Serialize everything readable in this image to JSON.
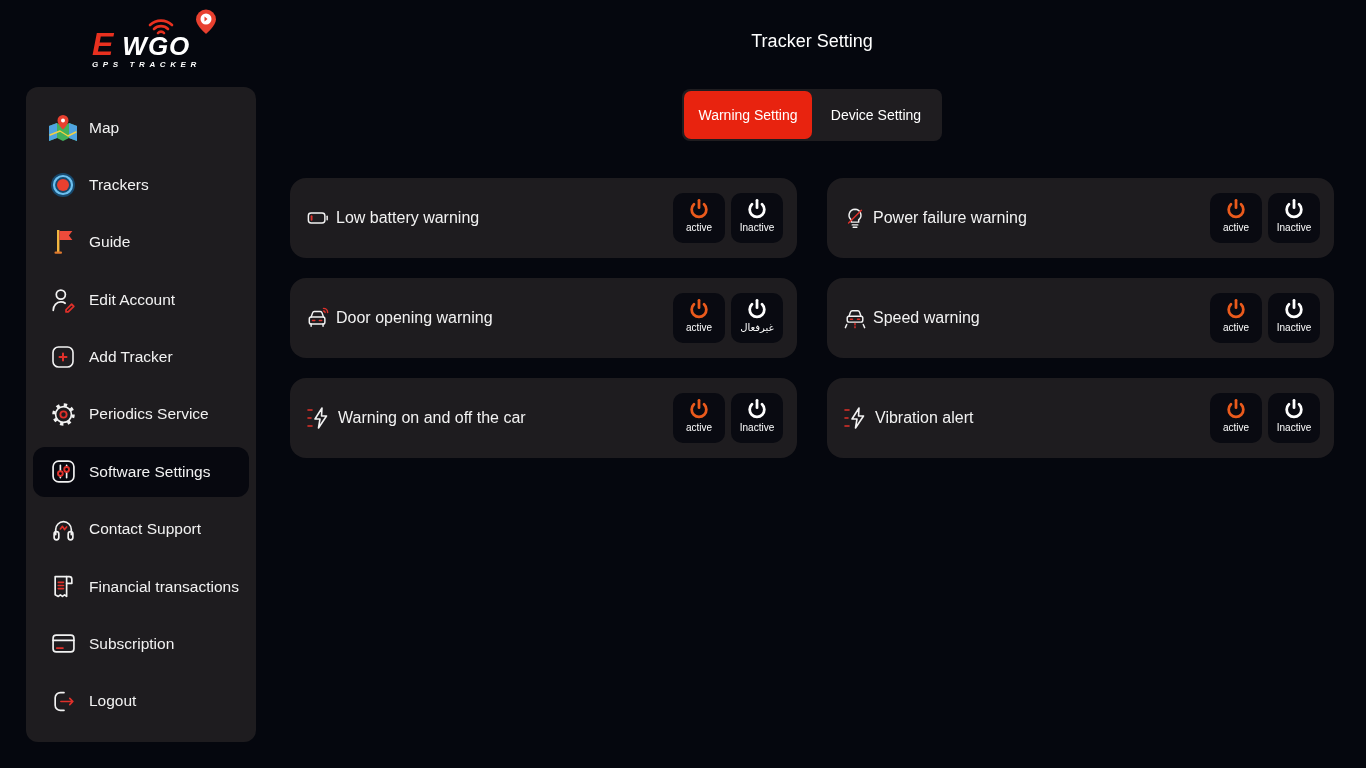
{
  "logo": {
    "mark": "E",
    "wordmark": "WGO",
    "tagline": "GPS TRACKER"
  },
  "sidebar": {
    "items": [
      {
        "label": "Map",
        "kind": "map",
        "selected": false
      },
      {
        "label": "Trackers",
        "kind": "target",
        "selected": false
      },
      {
        "label": "Guide",
        "kind": "flag",
        "selected": false
      },
      {
        "label": "Edit Account",
        "kind": "user",
        "selected": false
      },
      {
        "label": "Add Tracker",
        "kind": "plus",
        "selected": false
      },
      {
        "label": "Periodics Service",
        "kind": "gear",
        "selected": false
      },
      {
        "label": "Software Settings",
        "kind": "sliders",
        "selected": true
      },
      {
        "label": "Contact Support",
        "kind": "headset",
        "selected": false
      },
      {
        "label": "Financial transactions",
        "kind": "receipt",
        "selected": false
      },
      {
        "label": "Subscription",
        "kind": "card",
        "selected": false
      },
      {
        "label": "Logout",
        "kind": "logout",
        "selected": false
      }
    ]
  },
  "page": {
    "title": "Tracker Setting"
  },
  "tabs": [
    {
      "label": "Warning Setting",
      "selected": true
    },
    {
      "label": "Device Setting",
      "selected": false
    }
  ],
  "warnings": [
    {
      "title": "Low battery warning",
      "kind": "battery",
      "buttons": [
        {
          "kind": "on",
          "label": "active"
        },
        {
          "kind": "off",
          "label": "Inactive"
        }
      ]
    },
    {
      "title": "Power failure warning",
      "kind": "bulb",
      "buttons": [
        {
          "kind": "on",
          "label": "active"
        },
        {
          "kind": "off",
          "label": "Inactive"
        }
      ]
    },
    {
      "title": "Door opening warning",
      "kind": "door",
      "buttons": [
        {
          "kind": "on",
          "label": "active"
        },
        {
          "kind": "off",
          "label": "غيرفعال"
        }
      ]
    },
    {
      "title": "Speed warning",
      "kind": "speed",
      "buttons": [
        {
          "kind": "on",
          "label": "active"
        },
        {
          "kind": "off",
          "label": "Inactive"
        }
      ]
    },
    {
      "title": "Warning on and off the car",
      "kind": "ignition",
      "buttons": [
        {
          "kind": "on",
          "label": "active"
        },
        {
          "kind": "off",
          "label": "Inactive"
        }
      ]
    },
    {
      "title": "Vibration alert",
      "kind": "vibration",
      "buttons": [
        {
          "kind": "on",
          "label": "active"
        },
        {
          "kind": "off",
          "label": "Inactive"
        }
      ]
    }
  ]
}
